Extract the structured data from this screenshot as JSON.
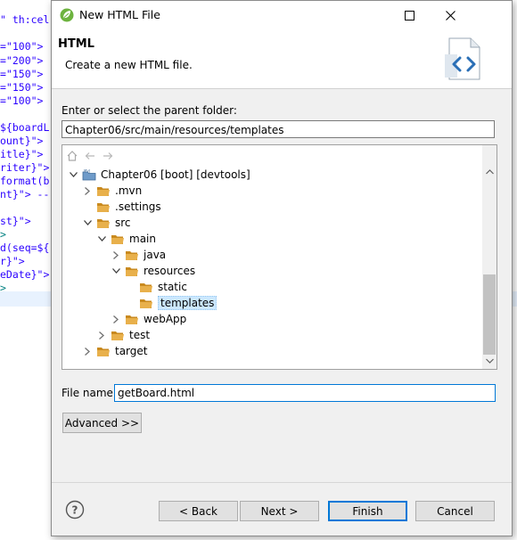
{
  "editor": {
    "lines": [
      {
        "text": "\" th:cel",
        "color": "#2a00ff"
      },
      {
        "text": "=\"100\">",
        "color": "#2a00ff"
      },
      {
        "text": "=\"200\">",
        "color": "#2a00ff"
      },
      {
        "text": "=\"150\">",
        "color": "#2a00ff"
      },
      {
        "text": "=\"150\">",
        "color": "#2a00ff"
      },
      {
        "text": "=\"100\">",
        "color": "#2a00ff"
      },
      {
        "text": "${boardL",
        "color": "#2a00ff"
      },
      {
        "text": "ount}\">",
        "color": "#2a00ff"
      },
      {
        "text": "itle}\">",
        "color": "#2a00ff"
      },
      {
        "text": "riter}\">",
        "color": "#2a00ff"
      },
      {
        "text": "format(b",
        "color": "#2a00ff"
      },
      {
        "text": "nt}\"> --",
        "color": "#2a00ff"
      },
      {
        "text": "st}\">",
        "color": "#2a00ff"
      },
      {
        "text": ">",
        "color": "#008080"
      },
      {
        "text": "d(seq=${",
        "color": "#2a00ff"
      },
      {
        "text": "r}\">",
        "color": "#2a00ff"
      },
      {
        "text": "eDate}\">",
        "color": "#2a00ff"
      },
      {
        "text": ">",
        "color": "#008080"
      }
    ]
  },
  "dialog": {
    "title": "New HTML File",
    "header_title": "HTML",
    "header_desc": "Create a new HTML file.",
    "folder_label": "Enter or select the parent folder:",
    "folder_value": "Chapter06/src/main/resources/templates",
    "tree": [
      {
        "label": "Chapter06 [boot] [devtools]",
        "expanded": true,
        "kind": "project"
      },
      {
        "label": ".mvn",
        "expanded": false,
        "kind": "folder"
      },
      {
        "label": ".settings",
        "expanded": null,
        "kind": "folder"
      },
      {
        "label": "src",
        "expanded": true,
        "kind": "folder"
      },
      {
        "label": "main",
        "expanded": true,
        "kind": "folder"
      },
      {
        "label": "java",
        "expanded": false,
        "kind": "folder"
      },
      {
        "label": "resources",
        "expanded": true,
        "kind": "folder"
      },
      {
        "label": "static",
        "expanded": null,
        "kind": "folder"
      },
      {
        "label": "templates",
        "expanded": null,
        "kind": "folder",
        "selected": true
      },
      {
        "label": "webApp",
        "expanded": false,
        "kind": "folder"
      },
      {
        "label": "test",
        "expanded": false,
        "kind": "folder"
      },
      {
        "label": "target",
        "expanded": false,
        "kind": "folder"
      }
    ],
    "filename_label": "File name:",
    "filename_value": "getBoard.html",
    "advanced_label": "Advanced >>",
    "back_label": "< Back",
    "next_label": "Next >",
    "finish_label": "Finish",
    "cancel_label": "Cancel"
  },
  "colors": {
    "folder": "#e8b04b",
    "folder_dark": "#c98a1f",
    "accent": "#0078d7",
    "selection": "#cce8ff"
  }
}
